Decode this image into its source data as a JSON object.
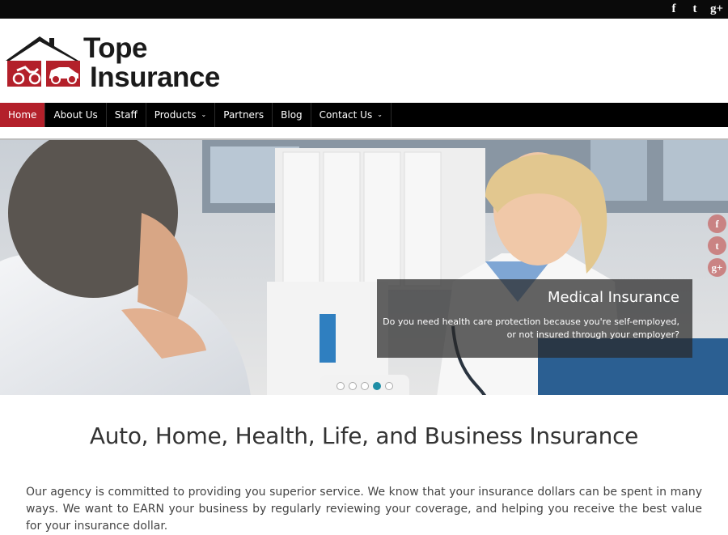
{
  "social": {
    "facebook": "f",
    "twitter": "t",
    "googleplus": "g+"
  },
  "logo": {
    "line1": "Tope",
    "line2": "Insurance"
  },
  "nav": {
    "items": [
      {
        "label": "Home"
      },
      {
        "label": "About Us"
      },
      {
        "label": "Staff"
      },
      {
        "label": "Products",
        "caret": "⌄"
      },
      {
        "label": "Partners"
      },
      {
        "label": "Blog"
      },
      {
        "label": "Contact Us",
        "caret": "⌄"
      }
    ]
  },
  "slider": {
    "title": "Medical Insurance",
    "text": "Do you need health care protection because you're self-employed, or not insured through your employer?",
    "slide_count": 5,
    "active_slide": 4
  },
  "main": {
    "title": "Auto, Home, Health, Life, and Business Insurance",
    "intro": "Our agency is committed to providing you superior service. We know that your insurance dollars can be spent in many ways. We want to EARN your business by regularly reviewing your coverage, and helping you receive the best value for your insurance dollar."
  },
  "colors": {
    "brand_red": "#b3202a",
    "nav_bg": "#000000",
    "dot_active": "#1f8ea6"
  }
}
